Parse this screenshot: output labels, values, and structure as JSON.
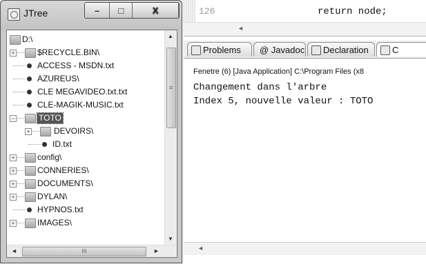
{
  "window": {
    "title": "JTree",
    "controls": {
      "minimize": "–",
      "maximize": "□",
      "close": "X"
    }
  },
  "tree": {
    "nodes": [
      {
        "label": "D:\\",
        "kind": "folder",
        "expanded": true
      },
      {
        "label": "$RECYCLE.BIN\\",
        "kind": "folder",
        "expander": "+"
      },
      {
        "label": "ACCESS - MSDN.txt",
        "kind": "file"
      },
      {
        "label": "AZUREUS\\",
        "kind": "file"
      },
      {
        "label": "CLE MEGAVIDEO.txt.txt",
        "kind": "file"
      },
      {
        "label": "CLE-MAGIK-MUSIC.txt",
        "kind": "file"
      },
      {
        "label": "TOTO",
        "kind": "folder",
        "expander": "−",
        "selected": true
      },
      {
        "label": "DEVOIRS\\",
        "kind": "folder",
        "expander": "+"
      },
      {
        "label": "ID.txt",
        "kind": "file"
      },
      {
        "label": "config\\",
        "kind": "folder",
        "expander": "+"
      },
      {
        "label": "CONNERIES\\",
        "kind": "folder",
        "expander": "+"
      },
      {
        "label": "DOCUMENTS\\",
        "kind": "folder",
        "expander": "+"
      },
      {
        "label": "DYLAN\\",
        "kind": "folder",
        "expander": "+"
      },
      {
        "label": "HYPNOS.txt",
        "kind": "file"
      },
      {
        "label": "IMAGES\\",
        "kind": "folder",
        "expander": "+"
      }
    ],
    "scroll": {
      "up": "▲",
      "down": "▼",
      "left": "◄",
      "right": "►",
      "grip_v": "≡",
      "grip_h": "III"
    }
  },
  "editor": {
    "line_number": "126",
    "code": "return node;",
    "scroll_left": "◄"
  },
  "views": {
    "tabs": [
      {
        "label": "Problems"
      },
      {
        "label": "@ Javadoc"
      },
      {
        "label": "Declaration"
      },
      {
        "label": "C"
      }
    ],
    "console_header": "Fenetre (6) [Java Application] C:\\Program Files (x8",
    "console_lines": [
      "Changement dans l'arbre",
      "Index 5, nouvelle valeur : TOTO"
    ],
    "scroll_left": "◄"
  }
}
